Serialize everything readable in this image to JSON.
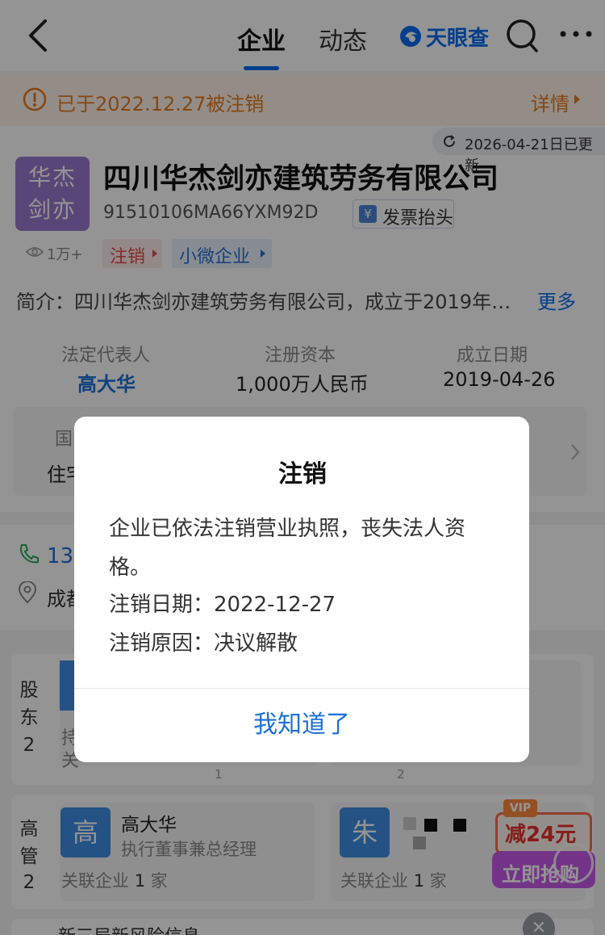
{
  "nav": {
    "tabs": [
      {
        "label": "企业",
        "active": true
      },
      {
        "label": "动态",
        "active": false
      }
    ],
    "brand": "天眼查",
    "accent_color": "#0a6cf0"
  },
  "banner": {
    "text": "已于2022.12.27被注销",
    "detail": "详情",
    "color": "#e67a1f"
  },
  "company": {
    "updated": "2026-04-21日已更新",
    "logo_line1": "华杰",
    "logo_line2": "剑亦",
    "name": "四川华杰剑亦建筑劳务有限公司",
    "credit_code": "91510106MA66YXM92D",
    "invoice_label": "发票抬头",
    "views": "1万+",
    "tags": [
      "注销",
      "小微企业"
    ],
    "intro": "简介：四川华杰剑亦建筑劳务有限公司，成立于2019年…",
    "intro_more": "更多",
    "stats": [
      {
        "label": "法定代表人",
        "value": "高大华"
      },
      {
        "label": "注册资本",
        "value": "1,000万人民币"
      },
      {
        "label": "成立日期",
        "value": "2019-04-26"
      }
    ],
    "sub_line1": "国",
    "sub_line2": "住宅"
  },
  "contact": {
    "phone": "135",
    "address": "成都"
  },
  "shareholders": {
    "label_chars": [
      "股",
      "东",
      "2"
    ],
    "line1": "持",
    "line2": "关",
    "indices": [
      "1",
      "2"
    ]
  },
  "executives": {
    "label_chars": [
      "高",
      "管",
      "2"
    ],
    "items": [
      {
        "avatar": "高",
        "name": "高大华",
        "role": "执行董事兼总经理",
        "related_prefix": "关联企业",
        "related_count": "1",
        "related_suffix": "家"
      },
      {
        "avatar": "朱",
        "name": "",
        "role": "",
        "related_prefix": "关联企业",
        "related_count": "1",
        "related_suffix": "家"
      }
    ]
  },
  "promo": {
    "vip": "VIP",
    "price": "减24元",
    "button": "立即抢购"
  },
  "risk": {
    "text": "新三局新风险信息"
  },
  "dialog": {
    "title": "注销",
    "line1": "企业已依法注销营业执照，丧失法人资",
    "line2": "格。",
    "date": "注销日期：2022-12-27",
    "reason": "注销原因：决议解散",
    "confirm": "我知道了"
  }
}
